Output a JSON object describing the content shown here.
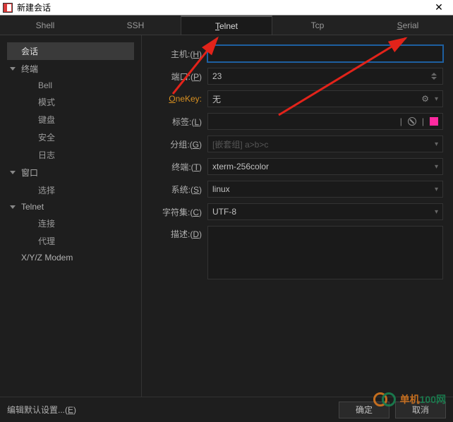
{
  "title": "新建会话",
  "tabs": [
    "Shell",
    "SSH",
    "Telnet",
    "Tcp",
    "Serial"
  ],
  "tabs_ul_index": {
    "2": "T",
    "4": "S"
  },
  "active_tab": 2,
  "sidebar": {
    "session": "会话",
    "groups": [
      {
        "label": "终端",
        "items": [
          "Bell",
          "模式",
          "键盘",
          "安全",
          "日志"
        ]
      },
      {
        "label": "窗口",
        "items": [
          "选择"
        ]
      },
      {
        "label": "Telnet",
        "items": [
          "连接",
          "代理"
        ]
      }
    ],
    "last": "X/Y/Z Modem"
  },
  "form": {
    "host_label_pre": "主机",
    "host_label_ul": "H",
    "host": "",
    "port_label_pre": "端口",
    "port_label_ul": "P",
    "port": "23",
    "onekey_label": "OneKey",
    "onekey": "无",
    "tag_label_pre": "标签",
    "tag_label_ul": "L",
    "tag": "",
    "group_label_pre": "分组",
    "group_label_ul": "G",
    "group_placeholder": "[嵌套组] a>b>c",
    "term_label_pre": "终端",
    "term_label_ul": "T",
    "term": "xterm-256color",
    "sys_label_pre": "系统",
    "sys_label_ul": "S",
    "sys": "linux",
    "charset_label_pre": "字符集",
    "charset_label_ul": "C",
    "charset": "UTF-8",
    "desc_label_pre": "描述",
    "desc_label_ul": "D",
    "desc": ""
  },
  "bottom": {
    "editdef_pre": "编辑默认设置...(",
    "editdef_ul": "E",
    "editdef_post": ")",
    "ok": "确定",
    "cancel": "取消"
  },
  "watermark": {
    "a": "单机",
    "b": "100网"
  }
}
